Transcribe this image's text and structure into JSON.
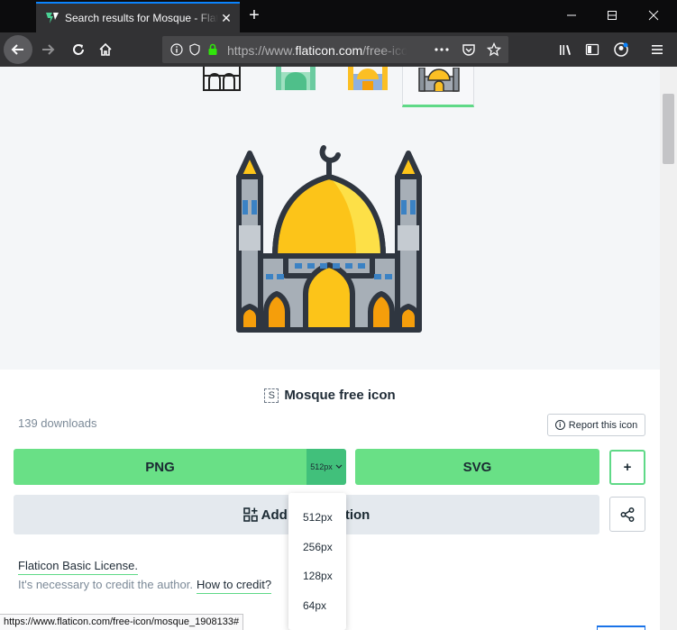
{
  "browser": {
    "tab_title": "Search results for Mosque - Flaticon",
    "url_prefix": "https://www.",
    "url_host": "flaticon.com",
    "url_path": "/free-icon/mosque_1908133",
    "new_tab_label": "+",
    "status_url": "https://www.flaticon.com/free-icon/mosque_1908133#"
  },
  "icon": {
    "title": "Mosque free icon",
    "style_badge": "S",
    "downloads": "139 downloads",
    "report_label": "Report this icon"
  },
  "download": {
    "png_label": "PNG",
    "size_selected": "512px",
    "svg_label": "SVG",
    "plus_label": "+",
    "collection_label_left": "Add",
    "collection_label_right": "tion"
  },
  "size_options": [
    "512px",
    "256px",
    "128px",
    "64px"
  ],
  "license": {
    "title": "Flaticon Basic License.",
    "credit_text": "It's necessary to credit the author.",
    "credit_link": "How to credit?"
  },
  "colors": {
    "accent_green": "#69e086",
    "dark_green": "#41c07b",
    "firefox_blue": "#0a84ff",
    "mosque_gold": "#fbbf24"
  }
}
